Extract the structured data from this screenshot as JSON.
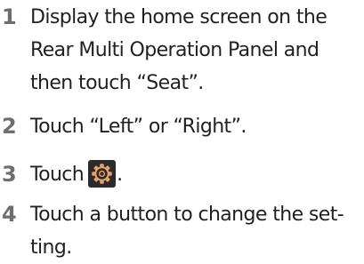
{
  "steps": [
    {
      "number": "1",
      "lines": [
        "Display the home screen on the",
        "Rear Multi Operation Panel and",
        "then touch “Seat”."
      ]
    },
    {
      "number": "2",
      "lines": [
        "Touch “Left” or “Right”."
      ]
    },
    {
      "number": "3",
      "text_before": "Touch",
      "icon": "gear-settings-icon",
      "text_after": "."
    },
    {
      "number": "4",
      "lines": [
        "Touch a button to change the set-",
        "ting."
      ]
    }
  ],
  "colors": {
    "text": "#231f20",
    "step_number": "#6e6e6e",
    "icon_background": "#2b2b2b",
    "icon_gear": "#e8a070"
  }
}
